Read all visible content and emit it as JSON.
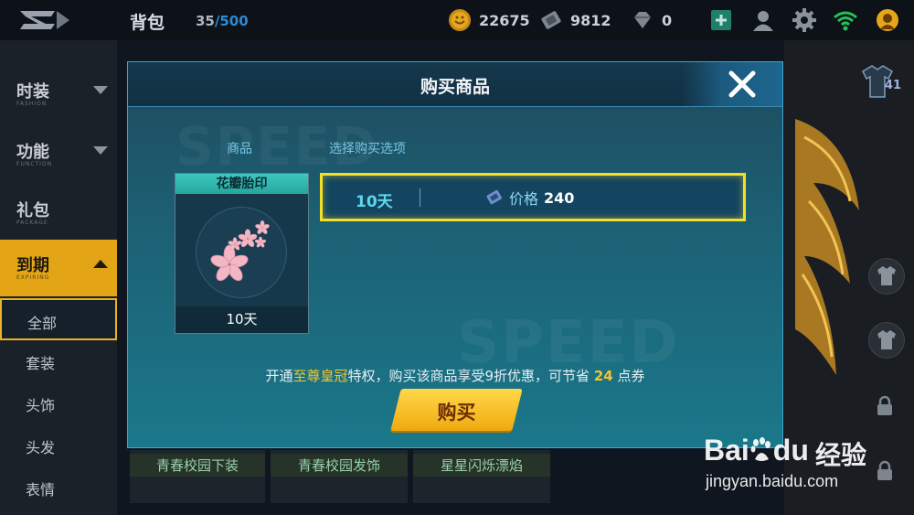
{
  "topbar": {
    "title": "背包",
    "count_current": "35",
    "count_max": "/500",
    "currencies": [
      {
        "icon": "coin-icon",
        "value": "22675"
      },
      {
        "icon": "ticket-icon",
        "value": "9812"
      },
      {
        "icon": "gem-icon",
        "value": "0"
      }
    ],
    "icons": [
      "add-icon",
      "friend-icon",
      "settings-icon",
      "wifi-icon",
      "avatar-icon"
    ]
  },
  "sidebar": {
    "categories": [
      {
        "label": "时装",
        "sub": "FASHION"
      },
      {
        "label": "功能",
        "sub": "FUNCTION"
      },
      {
        "label": "礼包",
        "sub": "PACKAGE"
      },
      {
        "label": "到期",
        "sub": "EXPIRING"
      }
    ],
    "subitems": [
      "全部",
      "套装",
      "头饰",
      "头发",
      "表情"
    ]
  },
  "background_items": [
    "青春校园下装",
    "青春校园发饰",
    "星星闪烁漂焰"
  ],
  "level_badge": "41",
  "modal": {
    "title": "购买商品",
    "goods_label": "商品",
    "options_label": "选择购买选项",
    "item": {
      "name": "花瓣胎印",
      "duration": "10天"
    },
    "option": {
      "duration": "10天",
      "price_label": "价格",
      "price_value": "240"
    },
    "promo": {
      "before": "开通",
      "highlight": "至尊皇冠",
      "middle": "特权，购买该商品享受9折优惠，可节省",
      "amount": "24",
      "after": "点券"
    },
    "buy_label": "购买"
  },
  "watermark": {
    "brand": "Bai",
    "brand2": "du",
    "jingyan": "经验",
    "url": "jingyan.baidu.com"
  },
  "colors": {
    "accent_yellow": "#f2df27",
    "highlight": "#f6c42c",
    "modal_bg": "#1d5f73",
    "tab_active": "#e3a516"
  }
}
